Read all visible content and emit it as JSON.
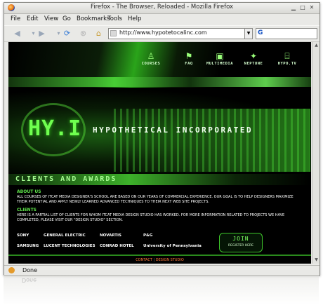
{
  "window": {
    "title": "Firefox - The Browser, Reloaded - Mozilla Firefox"
  },
  "menubar": {
    "items": [
      "File",
      "Edit",
      "View",
      "Go",
      "Bookmarks",
      "Tools",
      "Help"
    ]
  },
  "toolbar": {
    "back_icon": "back-arrow",
    "forward_icon": "forward-arrow",
    "reload_icon": "reload",
    "stop_icon": "stop",
    "home_icon": "home",
    "url_value": "http://www.hypotetocalinc.com",
    "search_engine_icon": "G"
  },
  "site": {
    "nav": [
      {
        "label": "COURSES",
        "icon": "person-icon"
      },
      {
        "label": "FAQ",
        "icon": "flag-icon"
      },
      {
        "label": "MULTIMEDIA",
        "icon": "screens-icon"
      },
      {
        "label": "NEPTUNE",
        "icon": "spark-icon"
      },
      {
        "label": "HYPO.TV",
        "icon": "tv-icon"
      }
    ],
    "logo_text": "HY.I",
    "company_name": "HYPOTHETICAL INCORPORATED",
    "section_title": "CLIENTS AND AWARDS",
    "about_heading": "ABOUT US",
    "about_text": "ALL COURSES OF ITCAT MEDIA DESIGNER'S SCHOOL ARE BASED ON OUR YEARS OF COMMERCIAL EXPERIENCE. OUR GOAL IS TO HELP DESIGNERS MAXIMIZE THEIR POTENTIAL AND APPLY NEWLY LEARNED ADVANCED TECHNIQUES TO THEIR NEXT WEB SITE PROJECTS.",
    "clients_heading": "CLIENTS",
    "clients_text": "HERE IS A PARTIAL LIST OF CLIENTS FOR WHOM ITCAT MEDIA DESIGN STUDIO HAS WORKED. FOR MORE INFORMATION RELATED TO PROJECTS WE HAVE COMPLETED, PLEASE VISIT OUR \"DESIGN STUDIO\" SECTION.",
    "clients": [
      [
        "SONY",
        "GENERAL ELECTRIC",
        "NOVARTIS",
        "P&G"
      ],
      [
        "SAMSUNG",
        "LUCENT TECHNOLOGIES",
        "CONRAD HOTEL",
        "University of Pennsylvania"
      ]
    ],
    "join": {
      "title": "JOIN",
      "subtitle": "REGISTER HERE"
    },
    "footer_links": [
      "CONTACT",
      "DESIGN STUDIO"
    ]
  },
  "status": {
    "text": "Done"
  }
}
